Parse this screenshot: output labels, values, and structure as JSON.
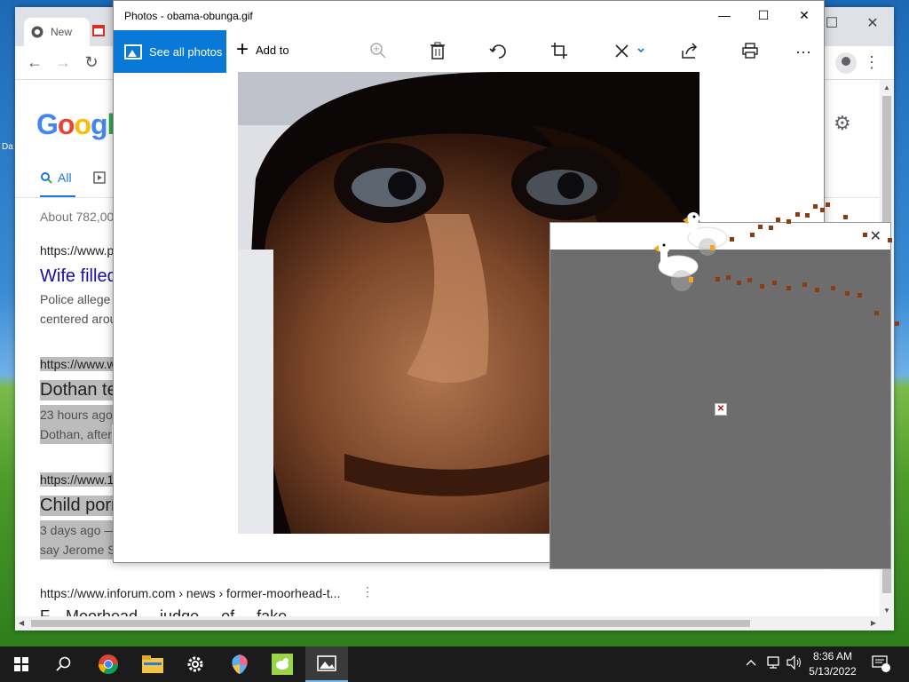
{
  "desktop": {
    "icon_label": "Da"
  },
  "chrome": {
    "tab_label": "New",
    "results_about": "About 782,00",
    "results": [
      {
        "url": "https://www.p",
        "title": "Wife filled",
        "snippet_lines": [
          "Police allege",
          "centered arou"
        ]
      },
      {
        "url": "https://www.w",
        "title": "Dothan te",
        "snippet_lines": [
          "23 hours ago",
          "Dothan, after"
        ]
      },
      {
        "url": "https://www.1",
        "title": "Child porn",
        "snippet_lines": [
          "3 days ago —",
          "say Jerome S"
        ]
      },
      {
        "url": "https://www.inforum.com › news › former-moorhead-t...",
        "title": "F... Moorhead ... judge ... of ... fake ...",
        "snippet_lines": []
      }
    ],
    "tab_all_label": "All"
  },
  "photos": {
    "title": "Photos - obama-obunga.gif",
    "see_all_label": "See all photos",
    "add_to_label": "Add to"
  },
  "taskbar": {
    "time": "8:36 AM",
    "date": "5/13/2022"
  }
}
